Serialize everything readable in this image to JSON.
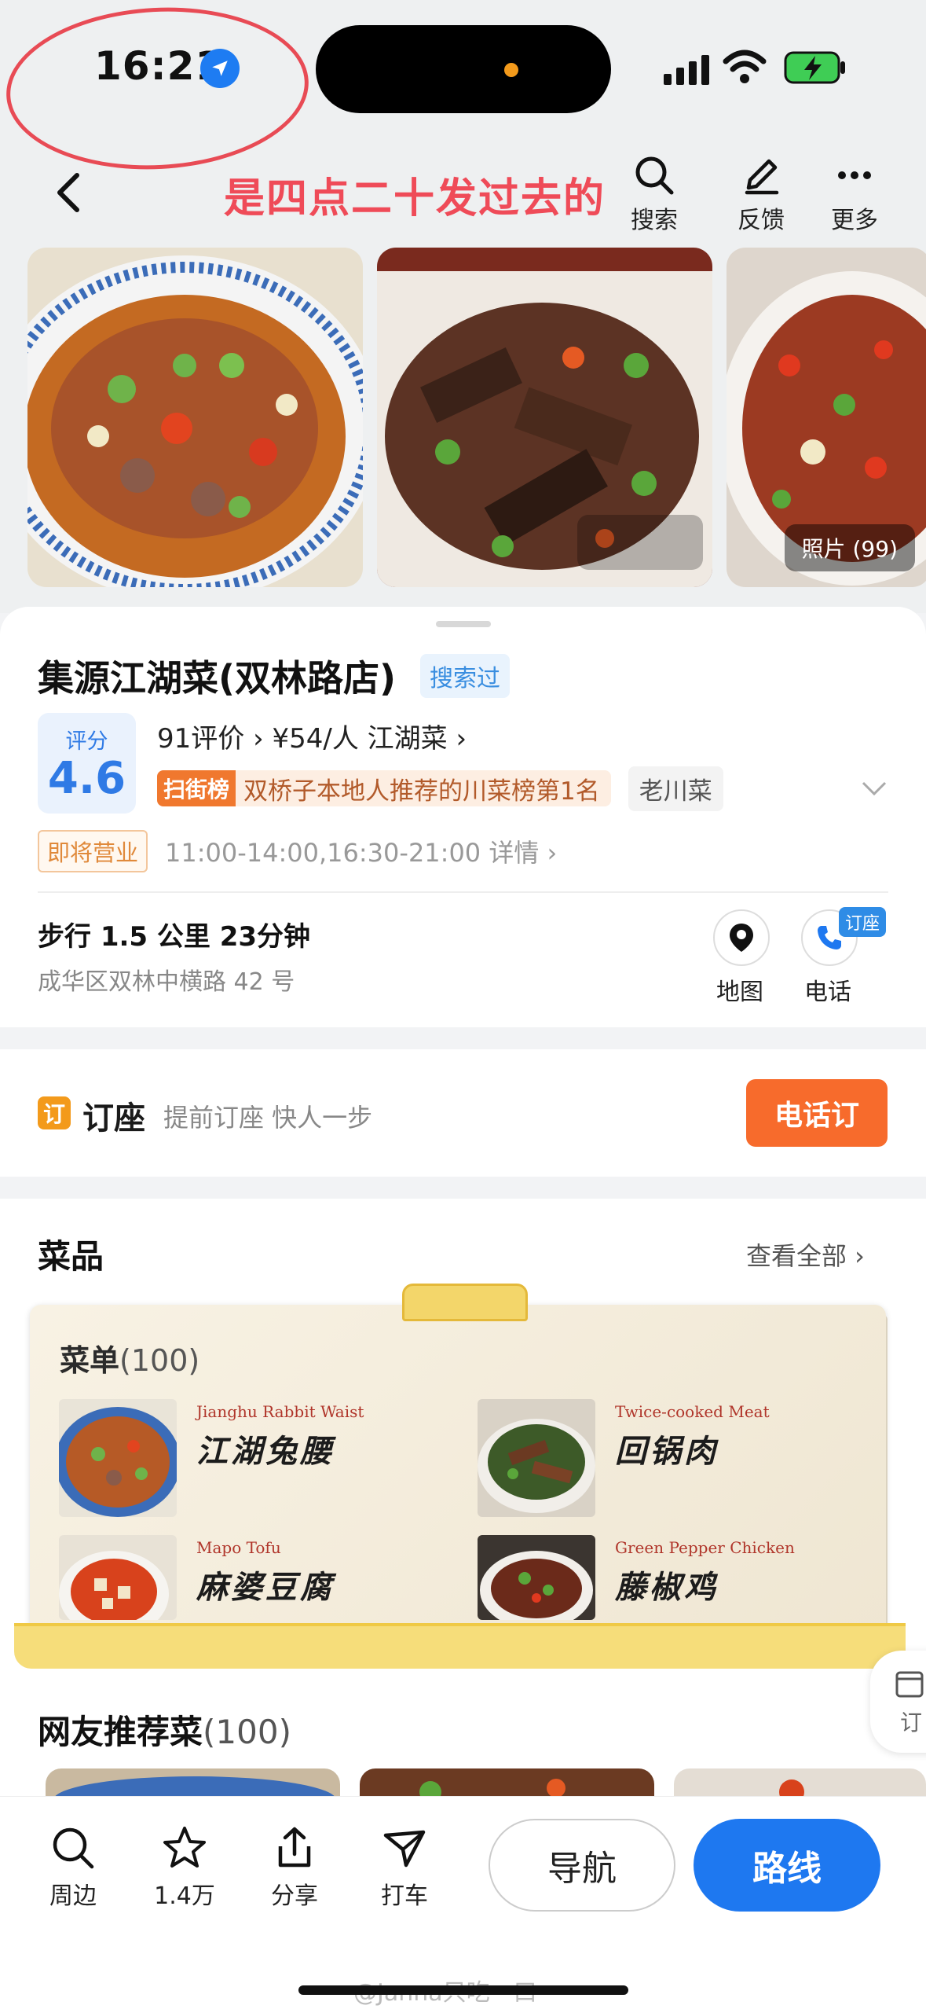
{
  "status_bar": {
    "time": "16:21"
  },
  "annotation": {
    "text": "是四点二十发过去的"
  },
  "header": {
    "search_label": "搜索",
    "feedback_label": "反馈",
    "more_label": "更多"
  },
  "photos": {
    "count_label": "照片 (99)"
  },
  "shop": {
    "name": "集源江湖菜(双林路店)",
    "searched_tag": "搜索过",
    "score_label": "评分",
    "score": "4.6",
    "reviews_line": "91评价 › ¥54/人 江湖菜 ›",
    "rank_logo": "扫街榜",
    "rank_text": "双桥子本地人推荐的川菜榜第1名",
    "rank_category": "老川菜",
    "open_badge": "即将营业",
    "hours": "11:00-14:00,16:30-21:00  详情 ›",
    "walk": "步行 1.5 公里 23分钟",
    "address": "成华区双林中横路 42 号",
    "map_label": "地图",
    "phone_label": "电话",
    "book_tag": "订座"
  },
  "reservation": {
    "icon": "订",
    "title": "订座",
    "subtitle": "提前订座 快人一步",
    "button": "电话订"
  },
  "dishes": {
    "title": "菜品",
    "see_all": "查看全部 ›",
    "menu_title": "菜单",
    "menu_count": "(100)",
    "items": [
      {
        "en": "Jianghu Rabbit Waist",
        "cn": "江湖兔腰"
      },
      {
        "en": "Twice-cooked Meat",
        "cn": "回锅肉"
      },
      {
        "en": "Mapo Tofu",
        "cn": "麻婆豆腐"
      },
      {
        "en": "Green Pepper Chicken",
        "cn": "藤椒鸡"
      }
    ],
    "float_book": "订",
    "rec_title": "网友推荐菜",
    "rec_count": "(100)"
  },
  "bottom_bar": {
    "nearby": "周边",
    "favorites": "1.4万",
    "share": "分享",
    "taxi": "打车",
    "navigate": "导航",
    "route": "路线"
  },
  "watermark": "@Janna只吃一口",
  "colors": {
    "accent_blue": "#1e78f0",
    "orange": "#f76b2c",
    "annotation_red": "#ef4b58"
  }
}
